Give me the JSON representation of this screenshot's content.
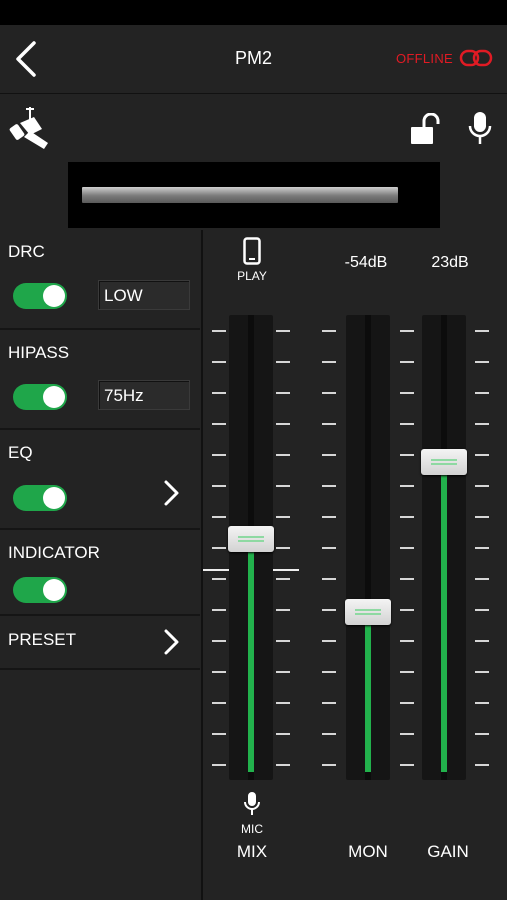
{
  "header": {
    "title": "PM2",
    "status": "OFFLINE"
  },
  "meter": {
    "level": 0.92
  },
  "settings": {
    "drc": {
      "label": "DRC",
      "enabled": true,
      "value": "LOW"
    },
    "hipass": {
      "label": "HIPASS",
      "enabled": true,
      "value": "75Hz"
    },
    "eq": {
      "label": "EQ",
      "enabled": true
    },
    "indicator": {
      "label": "INDICATOR",
      "enabled": true
    },
    "preset": {
      "label": "PRESET"
    }
  },
  "faders": {
    "mix": {
      "label": "MIX",
      "top_label": "PLAY",
      "bottom_label": "MIC",
      "position": 0.52
    },
    "mon": {
      "label": "MON",
      "readout": "-54dB",
      "position": 0.35
    },
    "gain": {
      "label": "GAIN",
      "readout": "23dB",
      "position": 0.7
    }
  },
  "colors": {
    "accent": "#22b14c",
    "offline": "#e01b24",
    "background": "#232323"
  }
}
